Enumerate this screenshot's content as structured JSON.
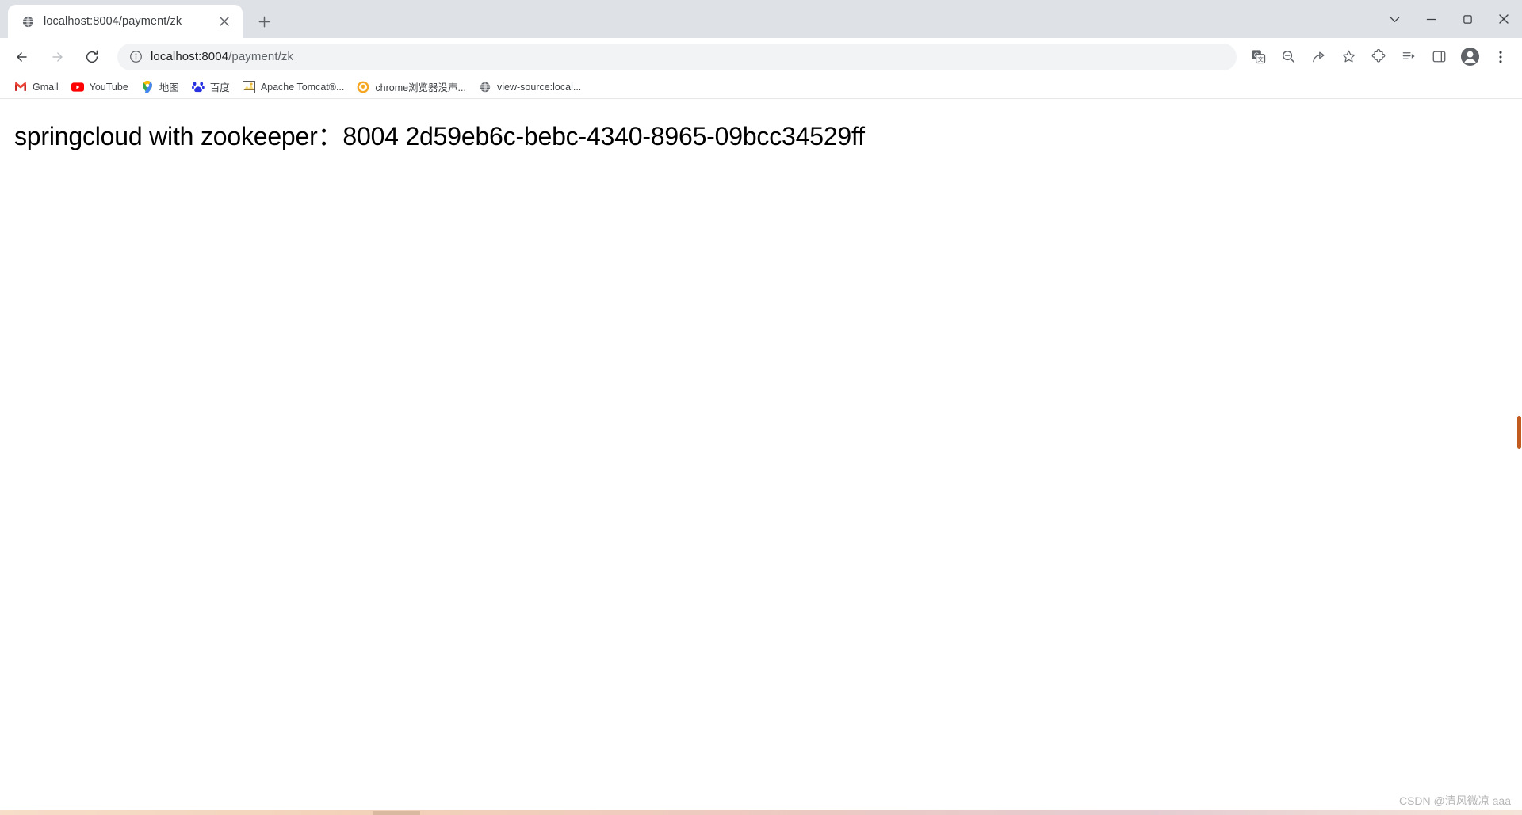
{
  "window": {
    "controls": {
      "minimize": "—",
      "maximize": "▢",
      "close": "✕",
      "tab_search": "⌄"
    }
  },
  "tabstrip": {
    "tabs": [
      {
        "title": "localhost:8004/payment/zk",
        "favicon": "globe-icon",
        "close_label": "✕"
      }
    ],
    "new_tab_label": "+"
  },
  "toolbar": {
    "back_label": "←",
    "forward_label": "→",
    "reload_label": "⟳",
    "omnibox": {
      "site_info_icon": "info-icon",
      "host": "localhost:8004",
      "path": "/payment/zk"
    },
    "icons": [
      {
        "name": "translate-icon",
        "glyph": "G"
      },
      {
        "name": "zoom-icon",
        "glyph": "⌕"
      },
      {
        "name": "share-icon",
        "glyph": "↗"
      },
      {
        "name": "bookmark-star-icon",
        "glyph": "☆"
      },
      {
        "name": "extensions-puzzle-icon",
        "glyph": "🧩"
      },
      {
        "name": "reading-list-icon",
        "glyph": "≔"
      },
      {
        "name": "side-panel-icon",
        "glyph": "▯"
      }
    ],
    "profile_label": "profile-avatar",
    "menu_label": "⋮"
  },
  "bookmarks": [
    {
      "label": "Gmail",
      "icon": "gmail-icon"
    },
    {
      "label": "YouTube",
      "icon": "youtube-icon"
    },
    {
      "label": "地图",
      "icon": "google-maps-icon"
    },
    {
      "label": "百度",
      "icon": "baidu-icon"
    },
    {
      "label": "Apache Tomcat®...",
      "icon": "tomcat-icon"
    },
    {
      "label": "chrome浏览器没声...",
      "icon": "chrome-sound-icon"
    },
    {
      "label": "view-source:local...",
      "icon": "globe-icon"
    }
  ],
  "page": {
    "heading": "springcloud with zookeeper：8004 2d59eb6c-bebc-4340-8965-09bcc34529ff",
    "watermark": "CSDN @清风微凉 aaa",
    "scrollbar_color": "#c05a1e"
  }
}
